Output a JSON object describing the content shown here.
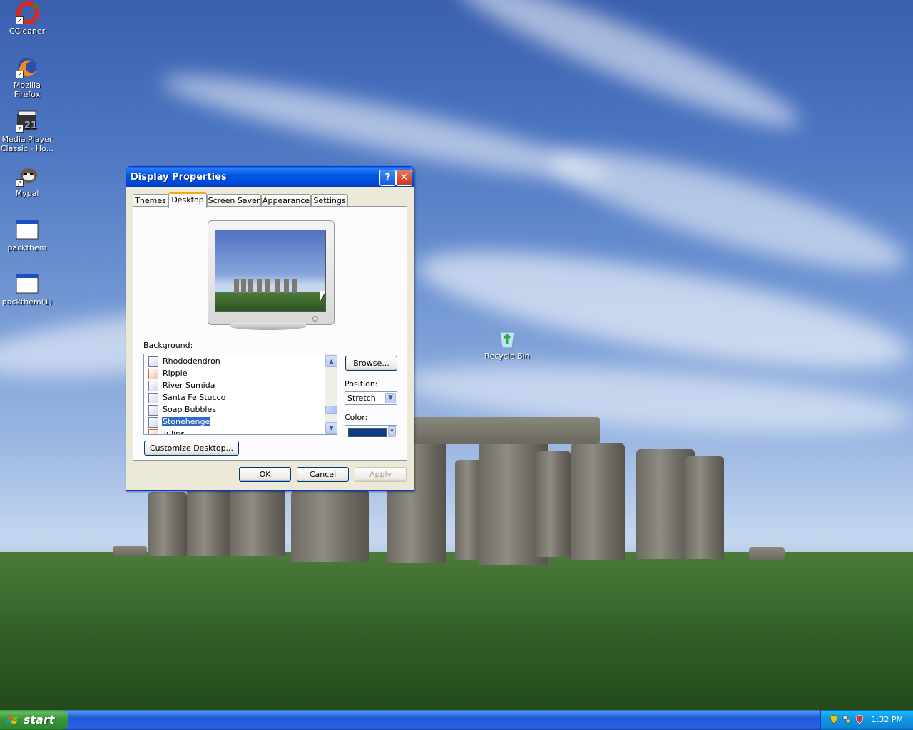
{
  "desktop": {
    "icons": [
      {
        "label": "CCleaner",
        "icon": "ccleaner-icon"
      },
      {
        "label": "Mozilla Firefox",
        "icon": "firefox-icon"
      },
      {
        "label": "Media Player\nClassic - Ho...",
        "line1": "Media Player",
        "line2": "Classic - Ho...",
        "icon": "media-player-classic-icon"
      },
      {
        "label": "Mypal",
        "icon": "mypal-icon"
      },
      {
        "label": "packthem",
        "icon": "application-window-icon"
      },
      {
        "label": "packthem(1)",
        "icon": "application-window-icon"
      },
      {
        "label": "Recycle Bin",
        "icon": "recycle-bin-icon"
      }
    ]
  },
  "dialog": {
    "title": "Display Properties",
    "help_label": "?",
    "close_label": "✕",
    "tabs": [
      {
        "label": "Themes",
        "active": false
      },
      {
        "label": "Desktop",
        "active": true
      },
      {
        "label": "Screen Saver",
        "active": false
      },
      {
        "label": "Appearance",
        "active": false
      },
      {
        "label": "Settings",
        "active": false
      }
    ],
    "background_label": "Background:",
    "background_items": [
      {
        "label": "Rhododendron",
        "selected": false
      },
      {
        "label": "Ripple",
        "selected": false
      },
      {
        "label": "River Sumida",
        "selected": false
      },
      {
        "label": "Santa Fe Stucco",
        "selected": false
      },
      {
        "label": "Soap Bubbles",
        "selected": false
      },
      {
        "label": "Stonehenge",
        "selected": true
      },
      {
        "label": "Tulips",
        "selected": false
      }
    ],
    "browse_label": "Browse...",
    "position_label": "Position:",
    "position_value": "Stretch",
    "color_label": "Color:",
    "color_value": "#0a3d8c",
    "customize_label": "Customize Desktop...",
    "ok_label": "OK",
    "cancel_label": "Cancel",
    "apply_label": "Apply"
  },
  "taskbar": {
    "start_label": "start",
    "clock": "1:32 PM",
    "tray_icons": [
      "security-shield-icon",
      "network-icon",
      "antivirus-shield-icon"
    ]
  },
  "colors": {
    "title_bar": "#0058e6",
    "selection": "#316ac5",
    "taskbar": "#245edb",
    "start_button": "#3c9a3c"
  }
}
